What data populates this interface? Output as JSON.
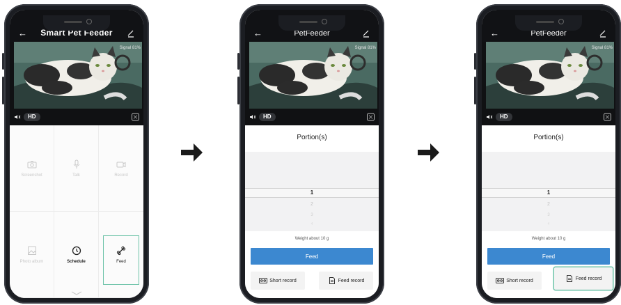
{
  "arrow_color": "#1a1a1a",
  "highlight_color": "#6cc3a8",
  "accent_color": "#3c88d0",
  "screen1": {
    "header": {
      "back_icon": "back-arrow-icon",
      "title": "Smart Pet Feeder",
      "edit_icon": "edit-icon"
    },
    "video": {
      "signal": "Signal 81%",
      "hd": "HD"
    },
    "grid": {
      "screenshot": "Screenshot",
      "talk": "Talk",
      "record": "Record",
      "photo_album": "Photo album",
      "schedule": "Schedule",
      "feed": "Feed"
    }
  },
  "screen2": {
    "header": {
      "title": "PetFeeder"
    },
    "video": {
      "signal": "Signal 81%",
      "hd": "HD"
    },
    "portion_title": "Portion(s)",
    "picker": [
      "1",
      "2",
      "3",
      "4"
    ],
    "weight": "Weight about 10 g",
    "feed_button": "Feed",
    "short_record": "Short record",
    "feed_record": "Feed record"
  },
  "screen3": {
    "header": {
      "title": "PetFeeder"
    },
    "video": {
      "signal": "Signal 81%",
      "hd": "HD"
    },
    "portion_title": "Portion(s)",
    "picker": [
      "1",
      "2",
      "3",
      "4"
    ],
    "weight": "Weight about 10 g",
    "feed_button": "Feed",
    "short_record": "Short record",
    "feed_record": "Feed record"
  }
}
